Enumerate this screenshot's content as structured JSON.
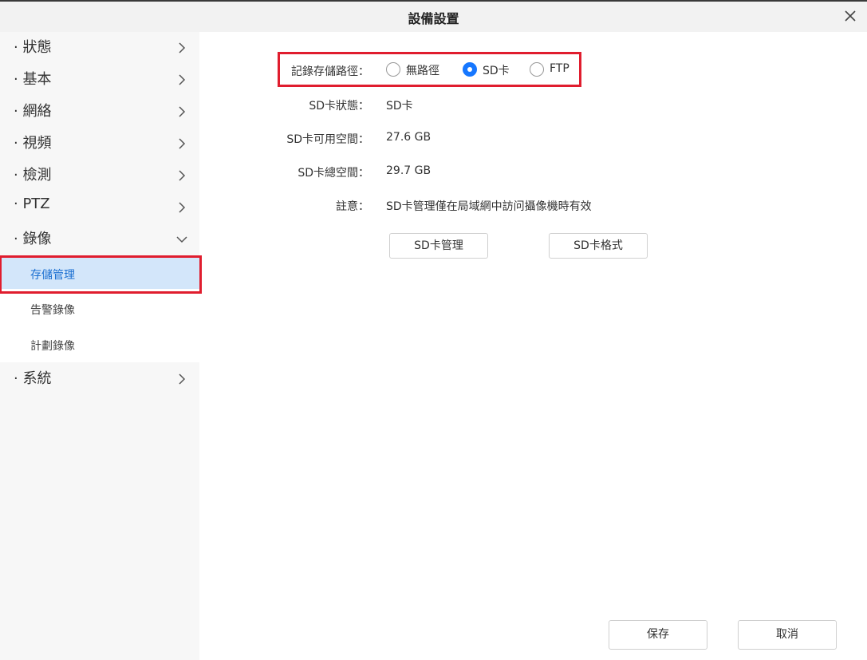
{
  "dialog": {
    "title": "設備設置"
  },
  "sidebar": {
    "items": [
      {
        "label": "· 狀態",
        "chevron": "chevron-right-icon"
      },
      {
        "label": "· 基本",
        "chevron": "chevron-right-icon"
      },
      {
        "label": "· 網絡",
        "chevron": "chevron-right-icon"
      },
      {
        "label": "· 視頻",
        "chevron": "chevron-right-icon"
      },
      {
        "label": "· 檢測",
        "chevron": "chevron-right-icon"
      },
      {
        "label": "· PTZ",
        "chevron": "chevron-right-icon"
      },
      {
        "label": "· 錄像",
        "chevron": "chevron-down-icon",
        "expanded": true
      },
      {
        "label": "· 系統",
        "chevron": "chevron-right-icon"
      }
    ],
    "recording_sub": [
      {
        "label": "存儲管理",
        "active": true
      },
      {
        "label": "告警錄像",
        "active": false
      },
      {
        "label": "計劃錄像",
        "active": false
      }
    ]
  },
  "storage": {
    "path_label": "記錄存儲路徑：",
    "path_options": [
      {
        "label": "無路徑",
        "checked": false
      },
      {
        "label": "SD卡",
        "checked": true
      },
      {
        "label": "FTP",
        "checked": false
      }
    ],
    "status_label": "SD卡狀態：",
    "status_value": "SD卡",
    "free_label": "SD卡可用空間：",
    "free_value": "27.6 GB",
    "total_label": "SD卡總空間：",
    "total_value": "29.7 GB",
    "note_label": "註意：",
    "note_value": "SD卡管理僅在局域網中訪问攝像機時有效",
    "manage_button": "SD卡管理",
    "format_button": "SD卡格式"
  },
  "footer": {
    "save_label": "保存",
    "cancel_label": "取消"
  },
  "colors": {
    "accent": "#1677ff",
    "highlight_box": "#e01d2e",
    "active_bg": "#d3e6fa"
  }
}
